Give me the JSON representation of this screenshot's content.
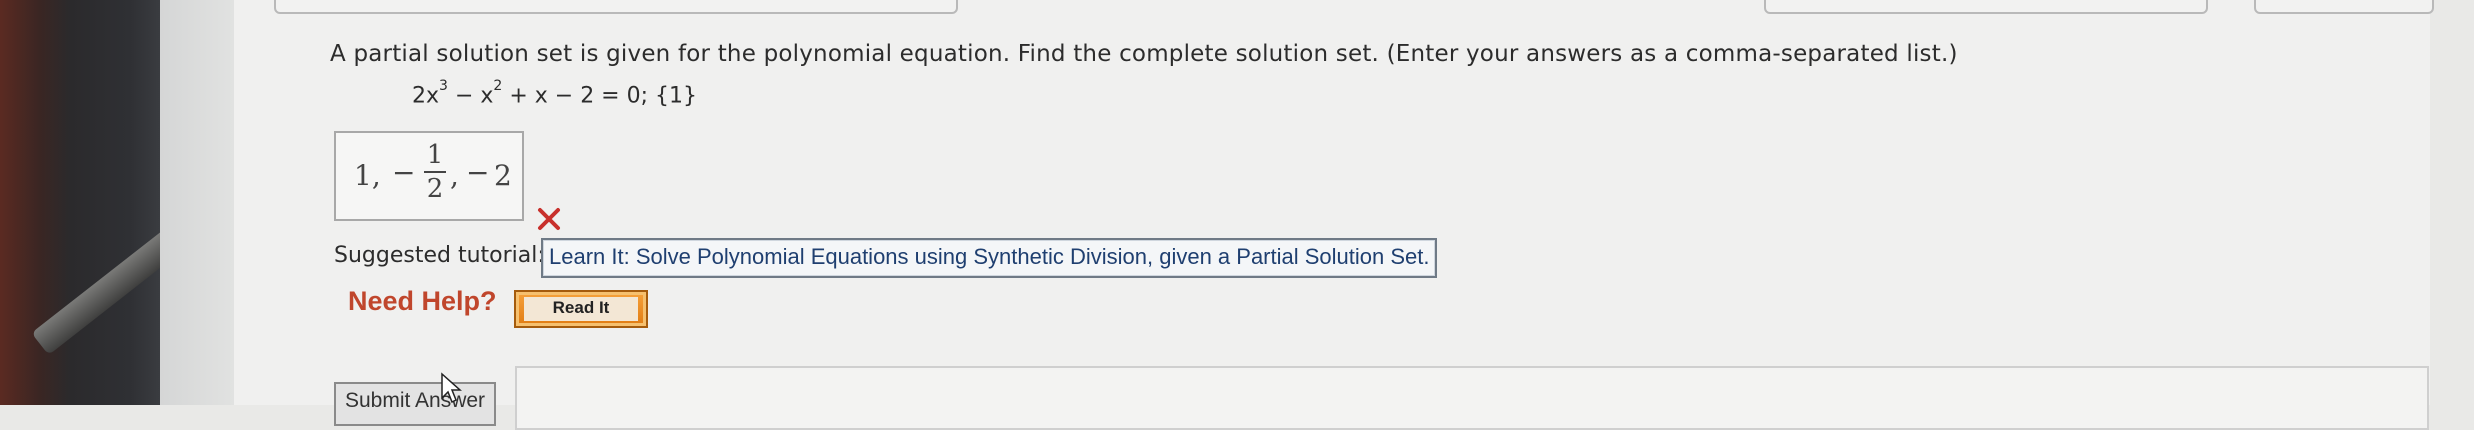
{
  "question": {
    "prompt": "A partial solution set is given for the polynomial equation. Find the complete solution set. (Enter your answers as a comma-separated list.)",
    "equation": {
      "c1": "2x",
      "e1": "3",
      "c2": " − x",
      "e2": "2",
      "rest": " + x − 2 = 0; {1}"
    }
  },
  "answer": {
    "one": "1,",
    "minus1": "−",
    "frac_num": "1",
    "frac_den": "2",
    "comma2": ",",
    "minus2": "−",
    "two": "2",
    "status": "incorrect"
  },
  "tutorial": {
    "label": "Suggested tutorial:",
    "link": "Learn It: Solve Polynomial Equations using Synthetic Division, given a Partial Solution Set."
  },
  "help": {
    "label": "Need Help?",
    "read_it": "Read It"
  },
  "actions": {
    "submit": "Submit Answer"
  },
  "colors": {
    "need_help": "#c0462c",
    "incorrect_mark": "#c8302c",
    "read_it_button": "#e98a1f",
    "link_text": "#1f3f70"
  }
}
